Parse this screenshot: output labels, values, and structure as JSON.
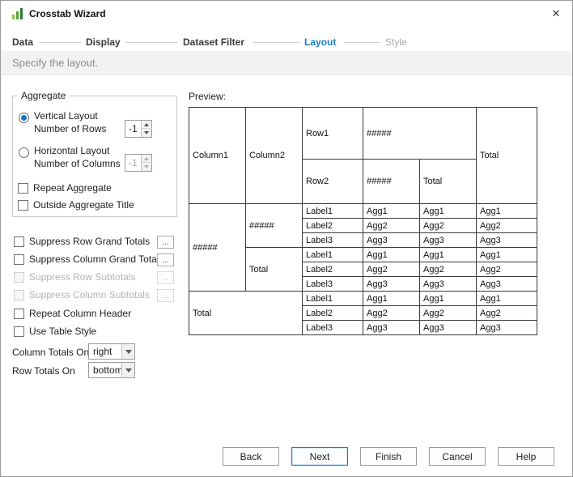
{
  "window": {
    "title": "Crosstab Wizard",
    "close_icon": "✕"
  },
  "steps": {
    "items": [
      {
        "label": "Data"
      },
      {
        "label": "Display"
      },
      {
        "label": "Dataset Filter"
      },
      {
        "label": "Layout"
      },
      {
        "label": "Style"
      }
    ],
    "active": "Layout"
  },
  "subtitle": "Specify the layout.",
  "colors": {
    "accent_blue": "#1a7dc2",
    "step_done": "#3a3a3a",
    "step_upcoming": "#a9a9a9",
    "icon_green": "#57a639"
  },
  "aggregate_group": {
    "title": "Aggregate",
    "vertical_layout": {
      "label": "Vertical Layout",
      "field_label": "Number of Rows",
      "value": "-1",
      "selected": true
    },
    "horizontal_layout": {
      "label": "Horizontal Layout",
      "field_label": "Number of Columns",
      "value": "-1",
      "selected": false
    },
    "repeat_aggregate": "Repeat Aggregate",
    "outside_aggregate_title": "Outside Aggregate Title"
  },
  "checkboxes": [
    {
      "label": "Suppress Row Grand Totals",
      "checked": false,
      "disabled": false,
      "more": "..."
    },
    {
      "label": "Suppress Column Grand Totals",
      "checked": false,
      "disabled": false,
      "more": "..."
    },
    {
      "label": "Suppress Row Subtotals",
      "checked": false,
      "disabled": true,
      "more": "..."
    },
    {
      "label": "Suppress Column Subtotals",
      "checked": false,
      "disabled": true,
      "more": "..."
    },
    {
      "label": "Repeat Column Header",
      "checked": false,
      "disabled": false
    },
    {
      "label": "Use Table Style",
      "checked": false,
      "disabled": false
    }
  ],
  "totals": {
    "column_totals_label": "Column Totals On",
    "column_totals_value": "right",
    "row_totals_label": "Row Totals On",
    "row_totals_value": "bottom"
  },
  "preview": {
    "label": "Preview:",
    "header": {
      "col1": "Column1",
      "col2": "Column2",
      "row1": "Row1",
      "row1_agg": "#####",
      "row2": "Row2",
      "row2_agg": "#####",
      "row2_total": "Total",
      "grand_total": "Total"
    },
    "body": {
      "group_header": "#####",
      "sub_header_1": "#####",
      "sub_header_2": "Total",
      "total_header": "Total",
      "rows": [
        {
          "label": "Label1",
          "c1": "Agg1",
          "c2": "Agg1",
          "c3": "Agg1"
        },
        {
          "label": "Label2",
          "c1": "Agg2",
          "c2": "Agg2",
          "c3": "Agg2"
        },
        {
          "label": "Label3",
          "c1": "Agg3",
          "c2": "Agg3",
          "c3": "Agg3"
        }
      ]
    }
  },
  "footer_buttons": {
    "back": "Back",
    "next": "Next",
    "finish": "Finish",
    "cancel": "Cancel",
    "help": "Help"
  }
}
